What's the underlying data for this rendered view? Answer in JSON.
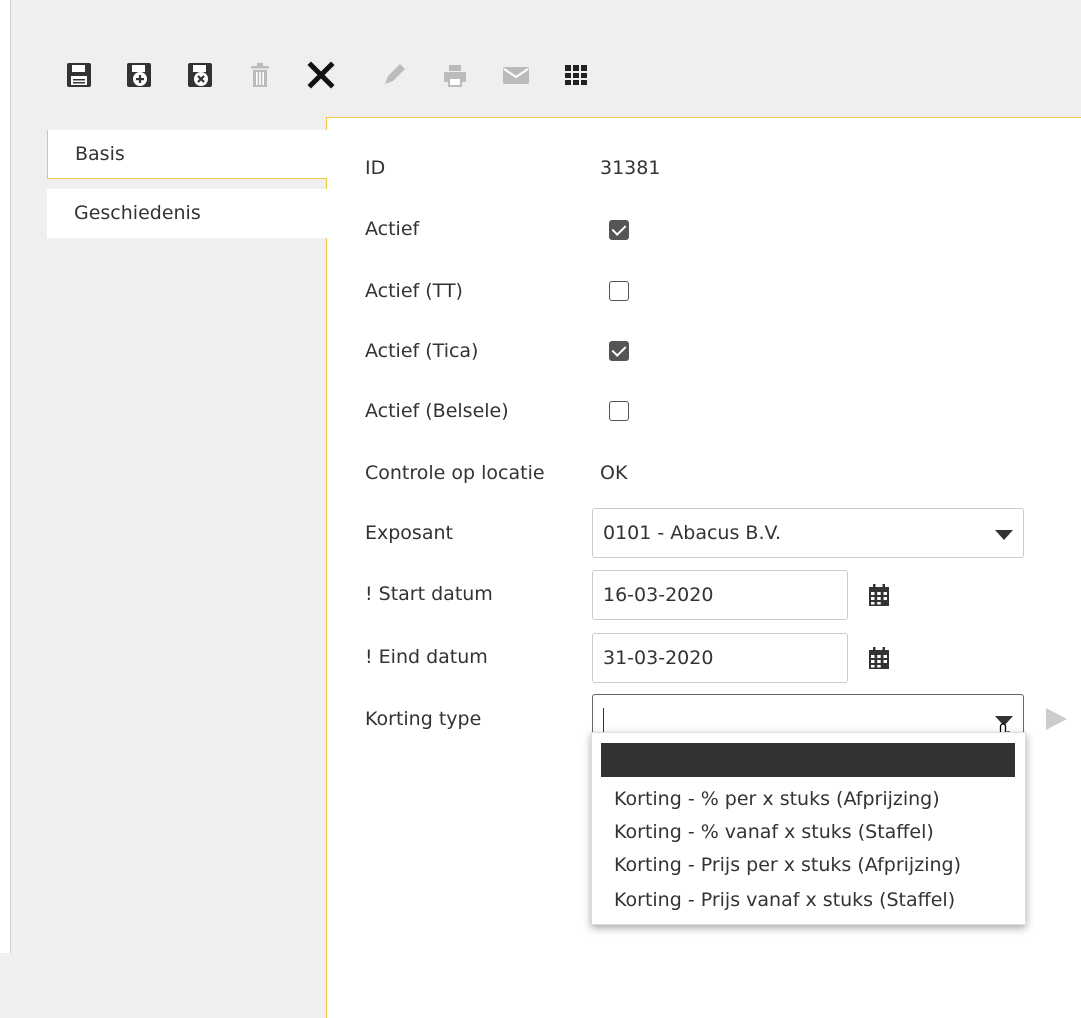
{
  "toolbar": {
    "buttons": [
      {
        "icon": "save-icon",
        "color": "#333333"
      },
      {
        "icon": "save-new-icon",
        "color": "#333333"
      },
      {
        "icon": "save-close-icon",
        "color": "#333333"
      },
      {
        "icon": "delete-icon",
        "color": "#bbbbbb"
      },
      {
        "icon": "close-icon",
        "color": "#111111"
      },
      {
        "icon": "edit-icon",
        "color": "#bbbbbb"
      },
      {
        "icon": "print-icon",
        "color": "#bbbbbb"
      },
      {
        "icon": "mail-icon",
        "color": "#bbbbbb"
      },
      {
        "icon": "grid-icon",
        "color": "#222222"
      }
    ]
  },
  "tabs": [
    {
      "label": "Basis",
      "active": true
    },
    {
      "label": "Geschiedenis",
      "active": false
    }
  ],
  "form": {
    "id": {
      "label": "ID",
      "value": "31381"
    },
    "actief": {
      "label": "Actief",
      "checked": true
    },
    "actief_tt": {
      "label": "Actief (TT)",
      "checked": false
    },
    "actief_tica": {
      "label": "Actief (Tica)",
      "checked": true
    },
    "actief_belsele": {
      "label": "Actief (Belsele)",
      "checked": false
    },
    "controle": {
      "label": "Controle op locatie",
      "value": "OK"
    },
    "exposant": {
      "label": "Exposant",
      "value": "0101 - Abacus B.V."
    },
    "start_datum": {
      "label": "! Start datum",
      "value": "16-03-2020"
    },
    "eind_datum": {
      "label": "! Eind datum",
      "value": "31-03-2020"
    },
    "korting_type": {
      "label": "Korting type",
      "value": "",
      "options": [
        "",
        "Korting - % per x stuks (Afprijzing)",
        "Korting - % vanaf x stuks (Staffel)",
        "Korting - Prijs per x stuks (Afprijzing)",
        "Korting - Prijs vanaf x stuks (Staffel)"
      ]
    }
  },
  "colors": {
    "accent": "#f2c73d",
    "background": "#efefef",
    "highlight": "#333333"
  }
}
